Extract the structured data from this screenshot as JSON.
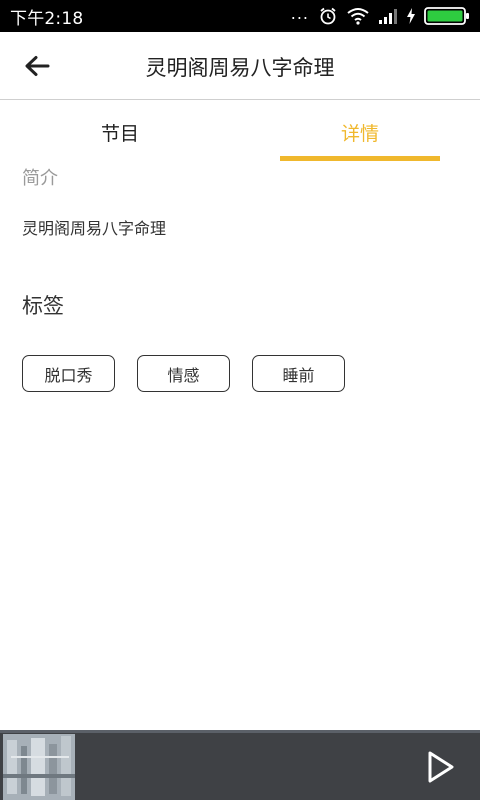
{
  "status_bar": {
    "time": "下午2:18",
    "dots": "...",
    "icons": [
      "alarm-icon",
      "wifi-icon",
      "signal-icon",
      "charging-icon",
      "battery-icon"
    ],
    "battery_color": "#2ecc40"
  },
  "header": {
    "back_icon": "arrow-left-icon",
    "title": "灵明阁周易八字命理"
  },
  "tabs": [
    {
      "label": "节目",
      "active": false
    },
    {
      "label": "详情",
      "active": true
    }
  ],
  "details": {
    "intro_label": "简介",
    "intro_text": "灵明阁周易八字命理",
    "tags_heading": "标签",
    "tags": [
      "脱口秀",
      "情感",
      "睡前"
    ]
  },
  "player": {
    "cover_icon": "album-cover-image",
    "play_icon": "play-icon"
  },
  "colors": {
    "accent": "#f0b82d",
    "player_bg": "#3f4145",
    "status_bg": "#000000"
  }
}
